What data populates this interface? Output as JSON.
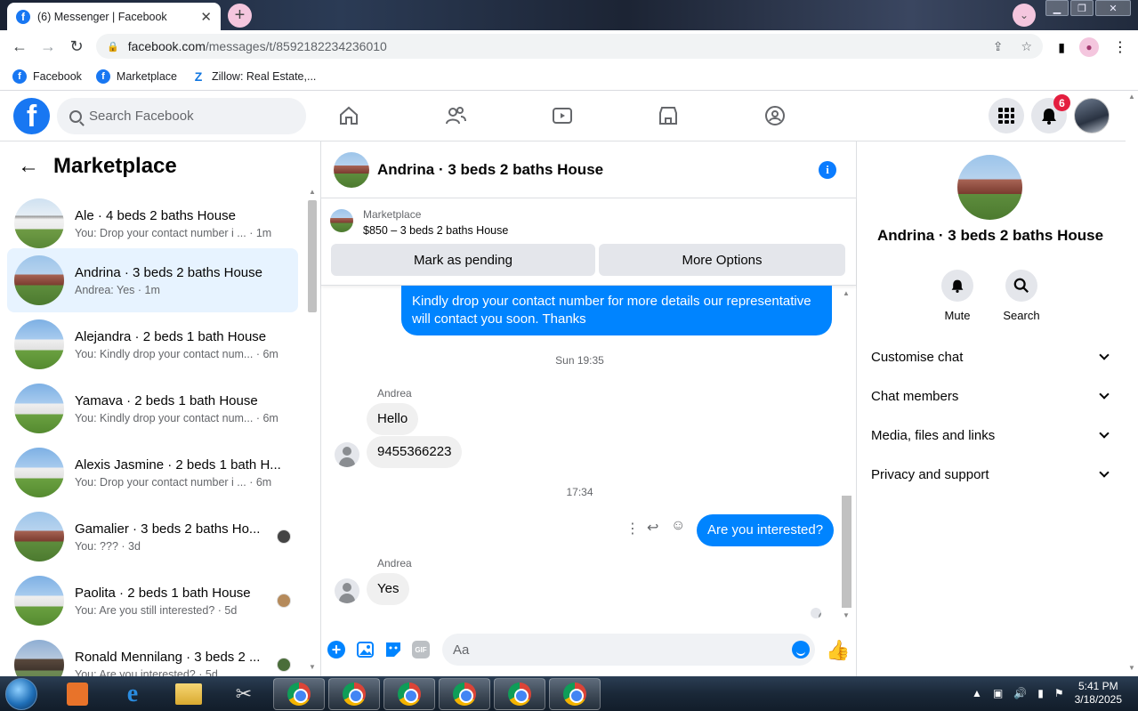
{
  "browser": {
    "tab_title": "(6) Messenger | Facebook",
    "url_host": "facebook.com",
    "url_path": "/messages/t/8592182234236010",
    "bookmarks": [
      "Facebook",
      "Marketplace",
      "Zillow: Real Estate,..."
    ]
  },
  "fb": {
    "search_placeholder": "Search Facebook",
    "notification_count": "6"
  },
  "left": {
    "title": "Marketplace",
    "conversations": [
      {
        "name": "Ale · 4 beds 2 baths House",
        "preview": "You: Drop your contact number i ...",
        "time": "· 1m"
      },
      {
        "name": "Andrina · 3 beds 2 baths House",
        "preview": "Andrea: Yes",
        "time": "· 1m"
      },
      {
        "name": "Alejandra · 2 beds 1 bath House",
        "preview": "You: Kindly drop your contact num...",
        "time": "· 6m"
      },
      {
        "name": "Yamava · 2 beds 1 bath House",
        "preview": "You: Kindly drop your contact num...",
        "time": "· 6m"
      },
      {
        "name": "Alexis Jasmine · 2 beds 1 bath H...",
        "preview": "You: Drop your contact number i ...",
        "time": "· 6m"
      },
      {
        "name": "Gamalier · 3 beds 2 baths Ho...",
        "preview": "You: ???",
        "time": "· 3d"
      },
      {
        "name": "Paolita · 2 beds 1 bath House",
        "preview": "You: Are you still interested?",
        "time": "· 5d"
      },
      {
        "name": "Ronald Mennilang · 3 beds 2 ...",
        "preview": "You: Are you interested?",
        "time": "· 5d"
      }
    ]
  },
  "chat": {
    "title": "Andrina · 3 beds 2 baths House",
    "card_label": "Marketplace",
    "card_price": "$850 – 3 beds 2 baths House",
    "btn_pending": "Mark as pending",
    "btn_more": "More Options",
    "messages": {
      "out1": "Kindly drop your contact number for more details our representative will contact you soon. Thanks",
      "time1": "Sun 19:35",
      "sender1": "Andrea",
      "in1": "Hello",
      "in2": "9455366223",
      "time2": "17:34",
      "out2": "Are you interested?",
      "sender2": "Andrea",
      "in3": "Yes"
    },
    "composer_placeholder": "Aa"
  },
  "right": {
    "name": "Andrina · 3 beds 2 baths House",
    "mute": "Mute",
    "search": "Search",
    "rows": [
      "Customise chat",
      "Chat members",
      "Media, files and links",
      "Privacy and support"
    ]
  },
  "taskbar": {
    "time": "5:41 PM",
    "date": "3/18/2025"
  },
  "colors": {
    "messenger_blue": "#0084ff",
    "facebook_blue": "#1877f2",
    "active_row": "#e7f3ff",
    "badge_red": "#e41e3f"
  }
}
